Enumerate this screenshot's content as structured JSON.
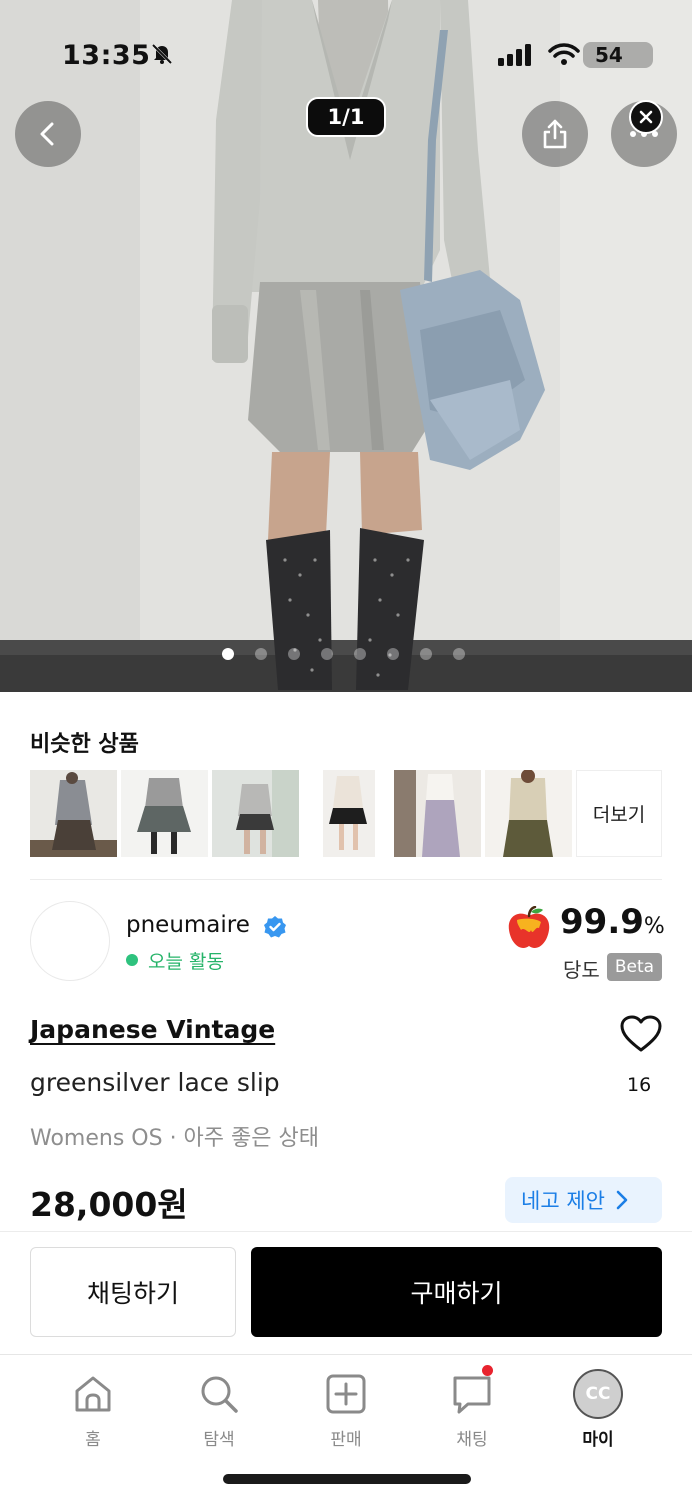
{
  "status_bar": {
    "time": "13:35",
    "battery": "54"
  },
  "gallery": {
    "counter": "1/1",
    "dots_total": 8,
    "dots_active_index": 0
  },
  "similar": {
    "title": "비슷한 상품",
    "more_label": "더보기",
    "thumbnail_count": 6
  },
  "seller": {
    "name": "pneumaire",
    "activity": "오늘 활동",
    "score": "99.9",
    "score_unit": "%",
    "score_label": "당도",
    "beta_badge": "Beta"
  },
  "product": {
    "brand": "Japanese Vintage",
    "name": "greensilver lace slip",
    "meta": "Womens OS · 아주 좋은 상태",
    "price": "28,000원",
    "likes": "16",
    "offer_label": "네고 제안"
  },
  "actions": {
    "chat_label": "채팅하기",
    "buy_label": "구매하기"
  },
  "tabbar": {
    "home": "홈",
    "search": "탐색",
    "sell": "판매",
    "chat": "채팅",
    "me": "마이",
    "me_initials": "CC"
  },
  "colors": {
    "accent_blue": "#1b7ee6",
    "offer_bg": "#e9f3fe",
    "active_green": "#27b46a",
    "notification_red": "#e8232e",
    "verified_blue": "#3897f0"
  }
}
